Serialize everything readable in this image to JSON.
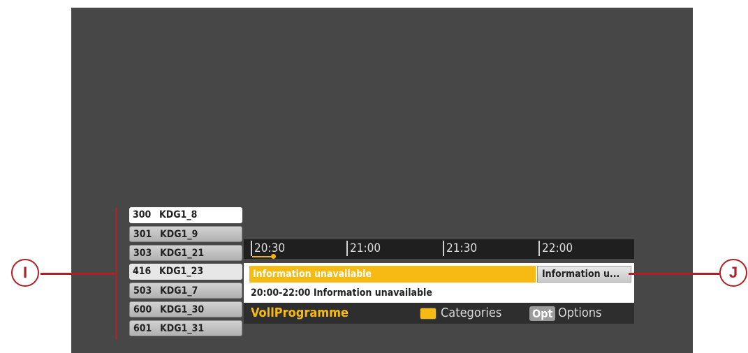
{
  "channels": [
    {
      "number": "300",
      "name": "KDG1_8"
    },
    {
      "number": "301",
      "name": "KDG1_9"
    },
    {
      "number": "303",
      "name": "KDG1_21"
    },
    {
      "number": "416",
      "name": "KDG1_23"
    },
    {
      "number": "503",
      "name": "KDG1_7"
    },
    {
      "number": "600",
      "name": "KDG1_30"
    },
    {
      "number": "601",
      "name": "KDG1_31"
    }
  ],
  "timeline": {
    "slots": [
      "20:30",
      "21:00",
      "21:30",
      "22:00"
    ]
  },
  "programs": {
    "current": "Information unavailable",
    "next": "Information u..."
  },
  "detail": {
    "time_range": "20:00-22:00",
    "title": "Information unavailable"
  },
  "footer": {
    "category": "VollProgramme",
    "categories_label": "Categories",
    "opt_key": "Opt",
    "options_label": "Options"
  },
  "callouts": {
    "left": "I",
    "right": "J"
  },
  "colors": {
    "accent": "#f6ba12",
    "callout": "#b11e24",
    "screen": "#474747"
  }
}
